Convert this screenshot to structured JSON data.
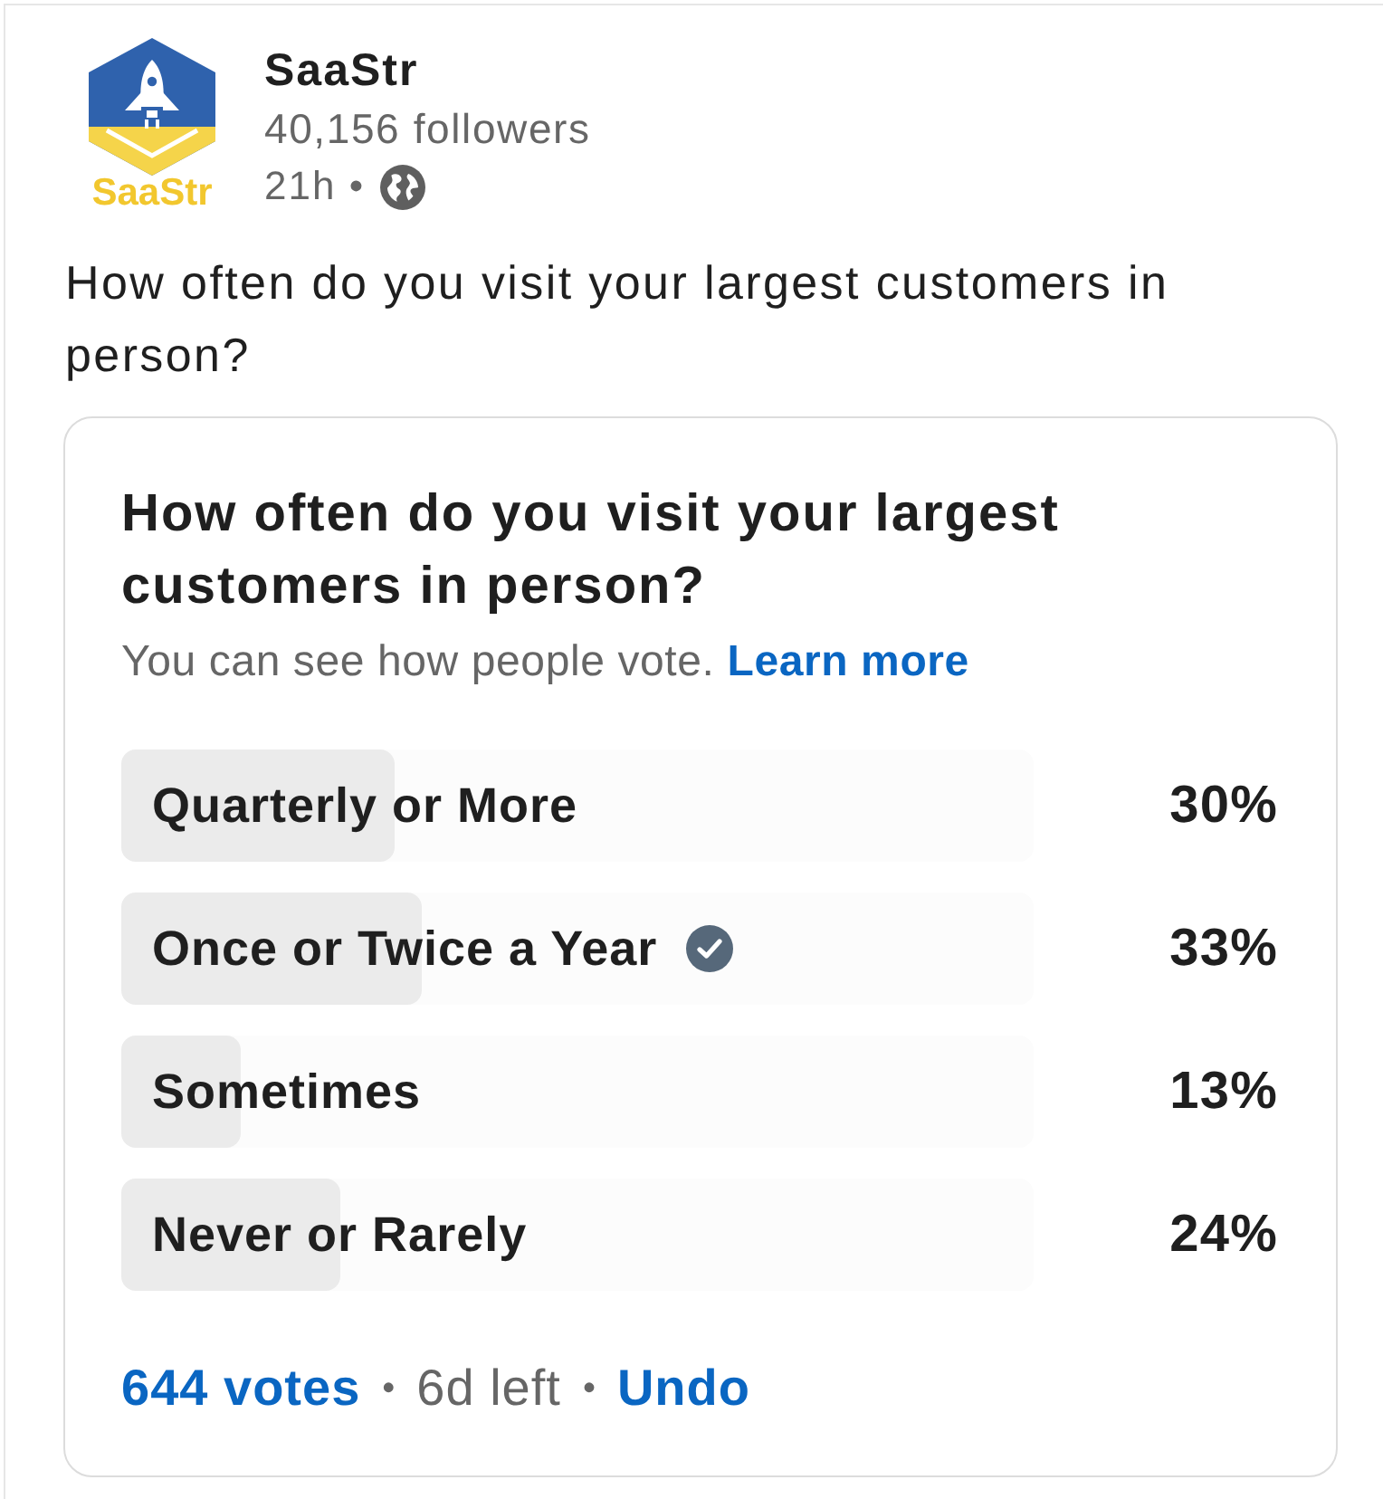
{
  "post": {
    "author": {
      "name": "SaaStr",
      "logo_text": "SaaStr",
      "followers": "40,156 followers",
      "time": "21h •"
    },
    "text": "How often do you visit your largest customers in person?"
  },
  "poll": {
    "question": "How often do you visit your largest customers in person?",
    "note": "You can see how people vote.",
    "learn_more": "Learn more",
    "options": [
      {
        "label": "Quarterly or More",
        "percent": "30%",
        "level": 0.3,
        "selected": false
      },
      {
        "label": "Once or Twice a Year",
        "percent": "33%",
        "level": 0.33,
        "selected": true
      },
      {
        "label": "Sometimes",
        "percent": "13%",
        "level": 0.13,
        "selected": false
      },
      {
        "label": "Never or Rarely",
        "percent": "24%",
        "level": 0.24,
        "selected": false
      }
    ],
    "footer": [
      {
        "kind": "link",
        "text": "644 votes"
      },
      {
        "kind": "separator",
        "text": "•"
      },
      {
        "kind": "text",
        "text": "6d left"
      },
      {
        "kind": "separator",
        "text": "•"
      },
      {
        "kind": "link",
        "text": "Undo"
      }
    ]
  }
}
